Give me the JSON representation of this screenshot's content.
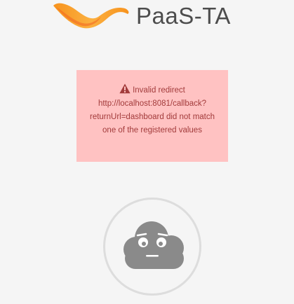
{
  "brand": {
    "logo_text": "PaaS-TA",
    "colors": {
      "swoosh_orange": "#f7931e",
      "swoosh_light": "#fbb040",
      "logo_text": "#4d4d4d"
    }
  },
  "error": {
    "icon": "warning-icon",
    "message": "Invalid redirect http://localhost:8081/callback?returnUrl=dashboard did not match one of the registered values",
    "colors": {
      "background": "#ffc2c2",
      "text": "#a23b3b"
    }
  },
  "illustration": {
    "icon": "sad-cloud-icon",
    "colors": {
      "cloud": "#8a8a8a",
      "ring": "#dddddd"
    }
  }
}
